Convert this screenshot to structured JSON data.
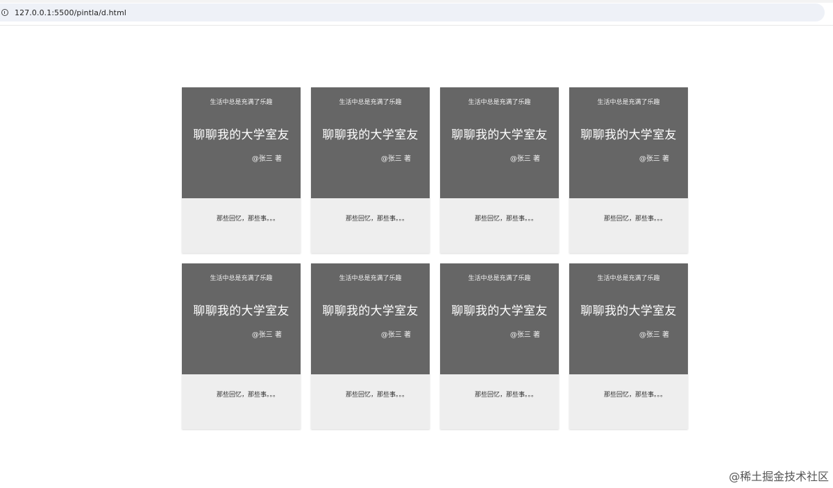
{
  "browser": {
    "url": "127.0.0.1:5500/pintla/d.html",
    "site_info_icon": "info-circle-icon"
  },
  "cards": [
    {
      "subtitle": "生活中总是充满了乐趣",
      "title": "聊聊我的大学室友",
      "author": "@张三 著",
      "description": "那些回忆，那些事。。。"
    },
    {
      "subtitle": "生活中总是充满了乐趣",
      "title": "聊聊我的大学室友",
      "author": "@张三 著",
      "description": "那些回忆，那些事。。。"
    },
    {
      "subtitle": "生活中总是充满了乐趣",
      "title": "聊聊我的大学室友",
      "author": "@张三 著",
      "description": "那些回忆，那些事。。。"
    },
    {
      "subtitle": "生活中总是充满了乐趣",
      "title": "聊聊我的大学室友",
      "author": "@张三 著",
      "description": "那些回忆，那些事。。。"
    },
    {
      "subtitle": "生活中总是充满了乐趣",
      "title": "聊聊我的大学室友",
      "author": "@张三 著",
      "description": "那些回忆，那些事。。。"
    },
    {
      "subtitle": "生活中总是充满了乐趣",
      "title": "聊聊我的大学室友",
      "author": "@张三 著",
      "description": "那些回忆，那些事。。。"
    },
    {
      "subtitle": "生活中总是充满了乐趣",
      "title": "聊聊我的大学室友",
      "author": "@张三 著",
      "description": "那些回忆，那些事。。。"
    },
    {
      "subtitle": "生活中总是充满了乐趣",
      "title": "聊聊我的大学室友",
      "author": "@张三 著",
      "description": "那些回忆，那些事。。。"
    }
  ],
  "colors": {
    "card_top": "#666666",
    "card_bottom": "#eeeeee"
  },
  "watermark": "@稀土掘金技术社区"
}
